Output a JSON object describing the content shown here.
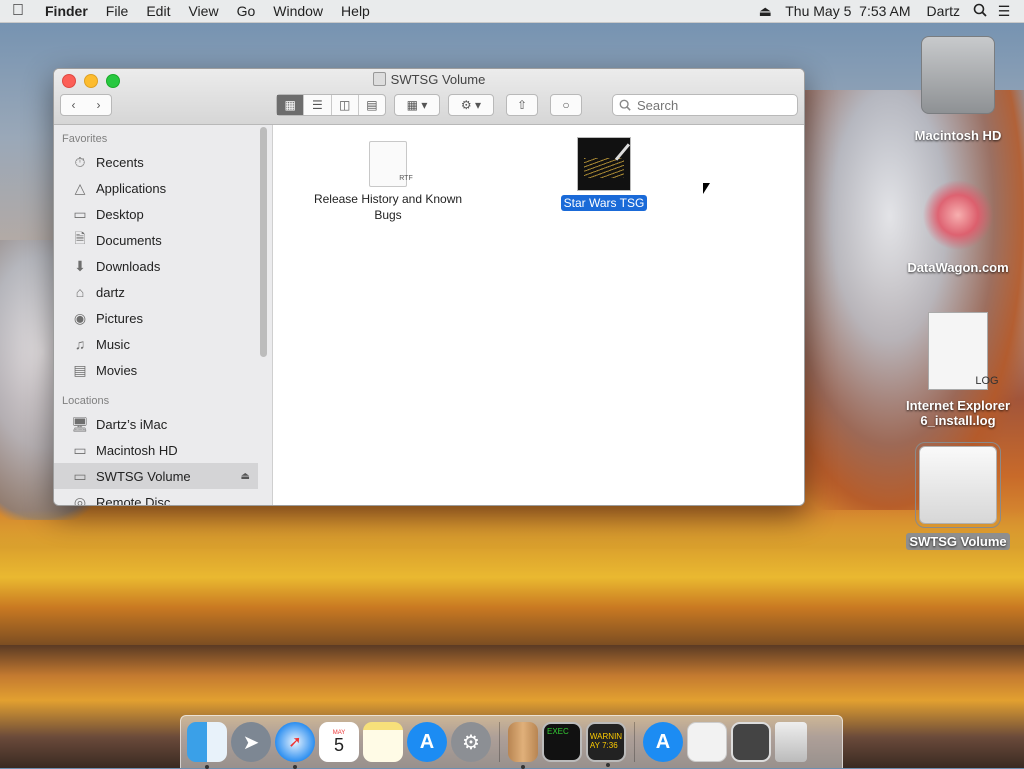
{
  "menubar": {
    "apple_icon": "apple-icon",
    "app_name": "Finder",
    "menus": [
      "File",
      "Edit",
      "View",
      "Go",
      "Window",
      "Help"
    ],
    "clock": "Thu May 5  7:53 AM",
    "user": "Dartz"
  },
  "window": {
    "title": "SWTSG Volume",
    "search_placeholder": "Search",
    "sidebar": {
      "favorites_header": "Favorites",
      "favorites": [
        "Recents",
        "Applications",
        "Desktop",
        "Documents",
        "Downloads",
        "dartz",
        "Pictures",
        "Music",
        "Movies"
      ],
      "locations_header": "Locations",
      "locations": [
        "Dartz’s iMac",
        "Macintosh HD",
        "SWTSG Volume",
        "Remote Disc"
      ],
      "selected": "SWTSG Volume"
    },
    "files": [
      {
        "name": "Release History and Known Bugs",
        "ext": "RTF",
        "selected": false
      },
      {
        "name": "Star Wars TSG",
        "selected": true
      }
    ]
  },
  "desktop": {
    "icons": [
      {
        "name": "Macintosh HD"
      },
      {
        "name": "DataWagon.com"
      },
      {
        "name": "Internet Explorer 6_install.log",
        "ext": "LOG"
      },
      {
        "name": "SWTSG Volume",
        "selected": true
      }
    ]
  },
  "dock": {
    "calendar_month": "MAY",
    "calendar_day": "5",
    "terminal_text": "EXEC",
    "console_text": "WARNIN\nAY 7:36"
  }
}
